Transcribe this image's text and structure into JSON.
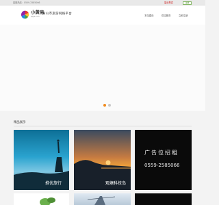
{
  "topbar": {
    "phone": "客服热线：0559-2585066",
    "login_label": "显示再试",
    "register_label": "注册"
  },
  "header": {
    "logo_title": "小黄易",
    "logo_subtitle": "apps.com",
    "slogan": "黄山市旅游网络平台",
    "nav": [
      "本站建设",
      "供应服务",
      "立即注册"
    ]
  },
  "section": {
    "title": "精品展示"
  },
  "gallery": [
    {
      "caption": "推优旅行"
    },
    {
      "caption": "观塘科技岛"
    },
    {
      "caption": "",
      "ad_title": "广告位招租",
      "ad_phone": "0559-2585066"
    }
  ],
  "colors": {
    "accent_red": "#cc0000",
    "dot_active": "#f08a1d",
    "dot_inactive": "#c8c8c8"
  }
}
